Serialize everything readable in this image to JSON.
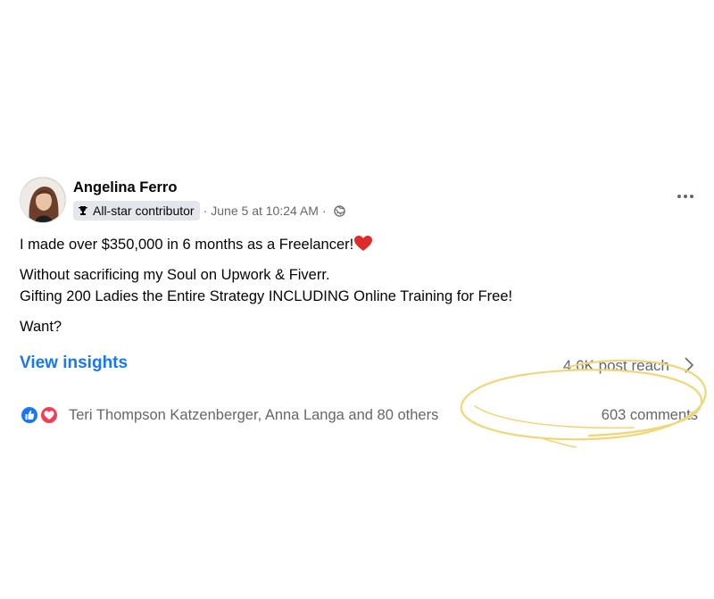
{
  "post": {
    "author": "Angelina Ferro",
    "badge": "All-star contributor",
    "timestamp": "June 5 at 10:24 AM",
    "separator": "·",
    "privacy_icon": "globe-icon",
    "badge_icon": "trophy-icon",
    "more_icon": "more-horizontal-icon",
    "body": {
      "line1": "I made over $350,000 in 6 months as a Freelancer!",
      "line2": "Without sacrificing my Soul on Upwork & Fiverr.",
      "line3": "Gifting 200 Ladies the Entire Strategy INCLUDING Online Training for Free!",
      "line4": "Want?"
    },
    "emoji_icon": "red-heart-icon"
  },
  "insights": {
    "label": "View insights",
    "reach": "4.6K post reach"
  },
  "reactions": {
    "icons": [
      "like-icon",
      "love-icon"
    ],
    "text": "Teri Thompson Katzenberger, Anna Langa and 80 others",
    "comments": "603 comments"
  },
  "colors": {
    "link": "#1877f2",
    "secondary_text": "#65676b",
    "like": "#1877f2",
    "love": "#f33e58",
    "highlight_scribble": "#f0d67a"
  }
}
